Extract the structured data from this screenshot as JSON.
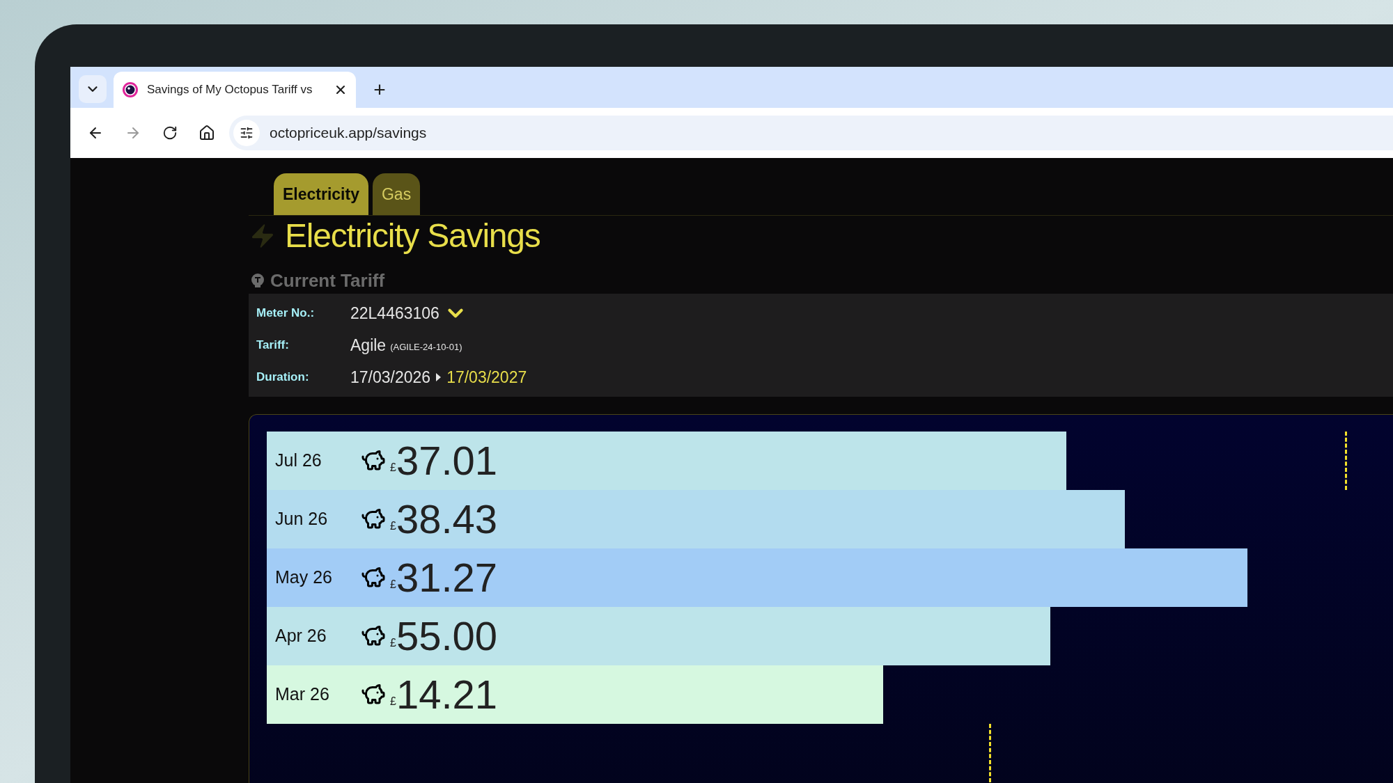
{
  "browser": {
    "tab_title": "Savings of My Octopus Tariff vs",
    "new_tab": "+",
    "url": "octopriceuk.app/savings"
  },
  "tabs": [
    {
      "label": "Electricity",
      "selected": true
    },
    {
      "label": "Gas",
      "selected": false
    }
  ],
  "title": "Electricity Savings",
  "section": "Current Tariff",
  "tariff": {
    "meter_label": "Meter No.:",
    "meter": "22L4463106",
    "tariff_label": "Tariff:",
    "tariff": "Agile",
    "tariff_code": "(AGILE-24-10-01)",
    "duration_label": "Duration:",
    "start": "17/03/2026",
    "end": "17/03/2027"
  },
  "savings": [
    {
      "month": "Jul 26",
      "currency": "£",
      "amount": "37.01",
      "color": "#bde4ea"
    },
    {
      "month": "Jun 26",
      "currency": "£",
      "amount": "38.43",
      "color": "#b3dcef"
    },
    {
      "month": "May 26",
      "currency": "£",
      "amount": "31.27",
      "color": "#a2ccf6"
    },
    {
      "month": "Apr 26",
      "currency": "£",
      "amount": "55.00",
      "color": "#bde4ea"
    },
    {
      "month": "Mar 26",
      "currency": "£",
      "amount": "14.21",
      "color": "#d6f8e0"
    }
  ]
}
